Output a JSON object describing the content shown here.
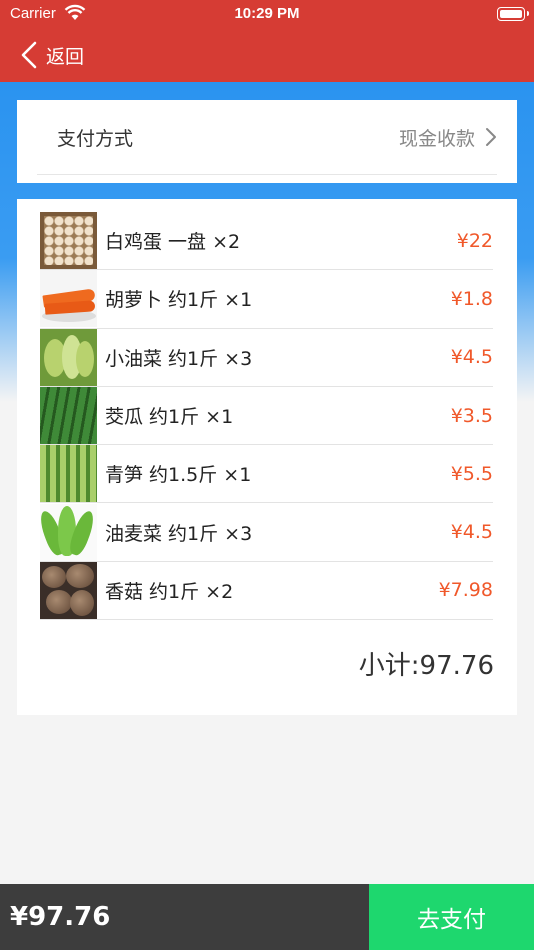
{
  "status_bar": {
    "carrier": "Carrier",
    "time": "10:29 PM"
  },
  "nav": {
    "back_label": "返回"
  },
  "payment": {
    "label": "支付方式",
    "value": "现金收款"
  },
  "items": [
    {
      "name": "白鸡蛋  一盘 ×2",
      "price": "¥22",
      "thumb": "egg-thumbnail"
    },
    {
      "name": "胡萝卜  约1斤 ×1",
      "price": "¥1.8",
      "thumb": "carrot-thumbnail"
    },
    {
      "name": "小油菜  约1斤 ×3",
      "price": "¥4.5",
      "thumb": "bok-choy-thumbnail"
    },
    {
      "name": "茭瓜  约1斤 ×1",
      "price": "¥3.5",
      "thumb": "cucumber-thumbnail"
    },
    {
      "name": "青笋  约1.5斤 ×1",
      "price": "¥5.5",
      "thumb": "lettuce-stem-thumbnail"
    },
    {
      "name": "油麦菜  约1斤 ×3",
      "price": "¥4.5",
      "thumb": "youmai-lettuce-thumbnail"
    },
    {
      "name": "香菇  约1斤 ×2",
      "price": "¥7.98",
      "thumb": "mushroom-thumbnail"
    }
  ],
  "subtotal": "小计:97.76",
  "footer": {
    "total": "¥97.76",
    "pay_label": "去支付"
  },
  "colors": {
    "header": "#d63c34",
    "price": "#f0582a",
    "pay_button": "#1ed76e",
    "footer_dark": "#3d3d3d"
  }
}
